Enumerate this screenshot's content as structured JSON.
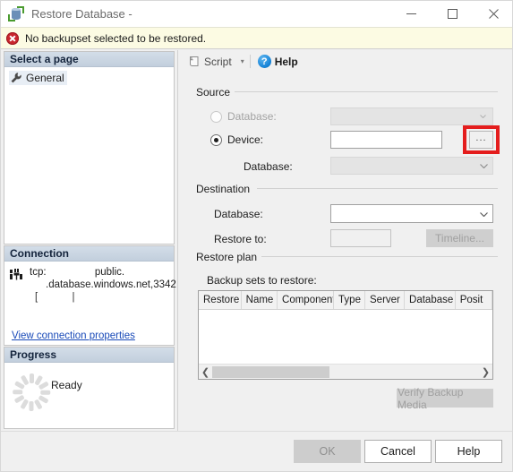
{
  "window": {
    "title": "Restore Database -",
    "icon": "database-restore-icon",
    "minimize": "minimize-icon",
    "maximize": "maximize-icon",
    "close": "close-icon"
  },
  "banner": {
    "icon": "error-icon",
    "message": "No backupset selected to be restored."
  },
  "sidebar": {
    "select_page": {
      "header": "Select a page",
      "items": [
        {
          "label": "General",
          "icon": "wrench-icon",
          "selected": true
        }
      ]
    },
    "connection": {
      "header": "Connection",
      "icon": "server-connection-icon",
      "line1": "tcp:                 public.",
      "line2": ".database.windows.net,3342",
      "line3": "[            |",
      "link": "View connection properties"
    },
    "progress": {
      "header": "Progress",
      "icon": "spinner-icon",
      "status": "Ready"
    }
  },
  "toolbar": {
    "script_label": "Script",
    "script_icon": "script-icon",
    "script_caret": "▾",
    "help_label": "Help",
    "help_icon": "help-icon",
    "help_glyph": "?"
  },
  "source": {
    "group_title": "Source",
    "database_radio_label": "Database:",
    "database_radio_selected": false,
    "database_radio_enabled": false,
    "device_radio_label": "Device:",
    "device_radio_selected": true,
    "device_radio_enabled": true,
    "device_value": "",
    "browse_button_label": "...",
    "browse_button_highlight_color": "#e41d1d",
    "database_label": "Database:",
    "database_value": ""
  },
  "destination": {
    "group_title": "Destination",
    "database_label": "Database:",
    "database_value": "",
    "restore_to_label": "Restore to:",
    "restore_to_value": "",
    "timeline_button_label": "Timeline..."
  },
  "restore_plan": {
    "group_title": "Restore plan",
    "subtitle": "Backup sets to restore:",
    "columns": [
      "Restore",
      "Name",
      "Component",
      "Type",
      "Server",
      "Database",
      "Posit"
    ],
    "rows": [],
    "scroll_left_icon": "chevron-left-icon",
    "scroll_right_icon": "chevron-right-icon",
    "verify_button_label": "Verify Backup Media"
  },
  "footer": {
    "ok_label": "OK",
    "ok_enabled": false,
    "cancel_label": "Cancel",
    "help_label": "Help"
  }
}
